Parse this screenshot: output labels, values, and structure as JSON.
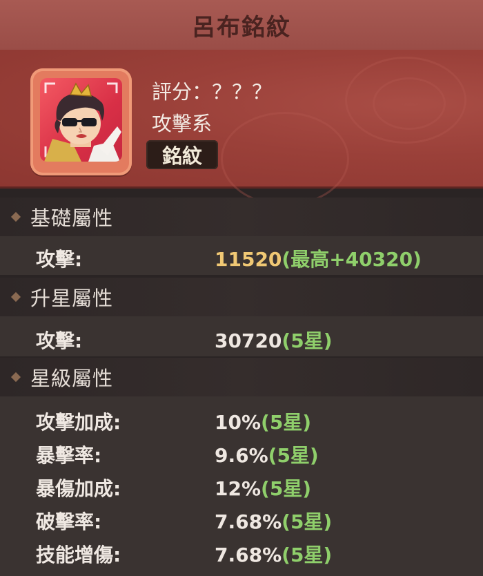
{
  "title": "呂布銘紋",
  "header": {
    "score_label": "評分：？？？",
    "type_label": "攻擊系",
    "tag_label": "銘紋"
  },
  "sections": [
    {
      "label": "基礎屬性",
      "rows": [
        {
          "key": "攻擊:",
          "value": "11520",
          "extra": "(最高+40320)"
        }
      ]
    },
    {
      "label": "升星屬性",
      "rows": [
        {
          "key": "攻擊:",
          "value": "30720",
          "extra": "(5星)"
        }
      ]
    },
    {
      "label": "星級屬性",
      "rows": [
        {
          "key": "攻擊加成:",
          "value": "10%",
          "extra": "(5星)"
        },
        {
          "key": "暴擊率:",
          "value": "9.6%",
          "extra": "(5星)"
        },
        {
          "key": "暴傷加成:",
          "value": "12%",
          "extra": "(5星)"
        },
        {
          "key": "破擊率:",
          "value": "7.68%",
          "extra": "(5星)"
        },
        {
          "key": "技能增傷:",
          "value": "7.68%",
          "extra": "(5星)"
        }
      ]
    }
  ],
  "colors": {
    "title_bar": "#a85a53",
    "header_bg": "#9a4039",
    "value_gold": "#f0c874",
    "value_green": "#8fcf6b",
    "panel_bg": "#3a3331"
  },
  "icons": {
    "avatar": "lu-bu-portrait-icon",
    "section_marker": "diamond-bullet-icon"
  }
}
